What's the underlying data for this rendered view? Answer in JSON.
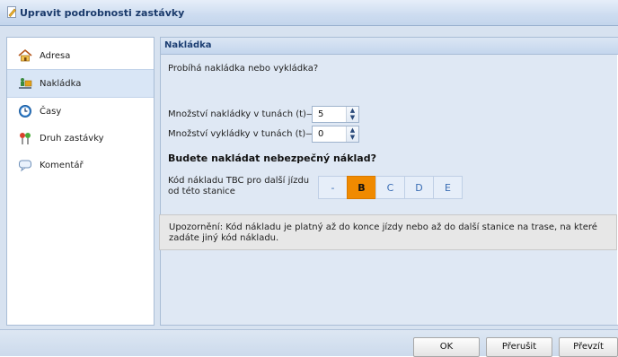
{
  "window": {
    "title": "Upravit podrobnosti zastávky"
  },
  "sidebar": {
    "items": [
      {
        "label": "Adresa",
        "icon": "house-icon"
      },
      {
        "label": "Nakládka",
        "icon": "loading-icon"
      },
      {
        "label": "Časy",
        "icon": "clock-icon"
      },
      {
        "label": "Druh zastávky",
        "icon": "map-pin-icon"
      },
      {
        "label": "Komentář",
        "icon": "comment-icon"
      }
    ],
    "active_index": 1
  },
  "panel": {
    "header": "Nakládka",
    "question": "Probíhá nakládka nebo vykládka?",
    "load_label": "Množství nakládky v tunách (t)",
    "load_value": "5",
    "unload_label": "Množství vykládky v tunách (t)",
    "unload_value": "0",
    "hazard_heading": "Budete nakládat nebezpečný náklad?",
    "tbc_label": "Kód nákladu TBC pro další jízdu od této stanice",
    "tbc_options": [
      "-",
      "B",
      "C",
      "D",
      "E"
    ],
    "tbc_selected": "B",
    "notice": "Upozornění: Kód nákladu je platný až do konce jízdy nebo až do další stanice na trase, na které zadáte jiný kód nákladu."
  },
  "footer": {
    "ok": "OK",
    "interrupt": "Přerušit",
    "take_over": "Převzít"
  },
  "colors": {
    "accent": "#f08a00",
    "header_text": "#1d3f73",
    "frame_bg": "#d7e2f0"
  }
}
